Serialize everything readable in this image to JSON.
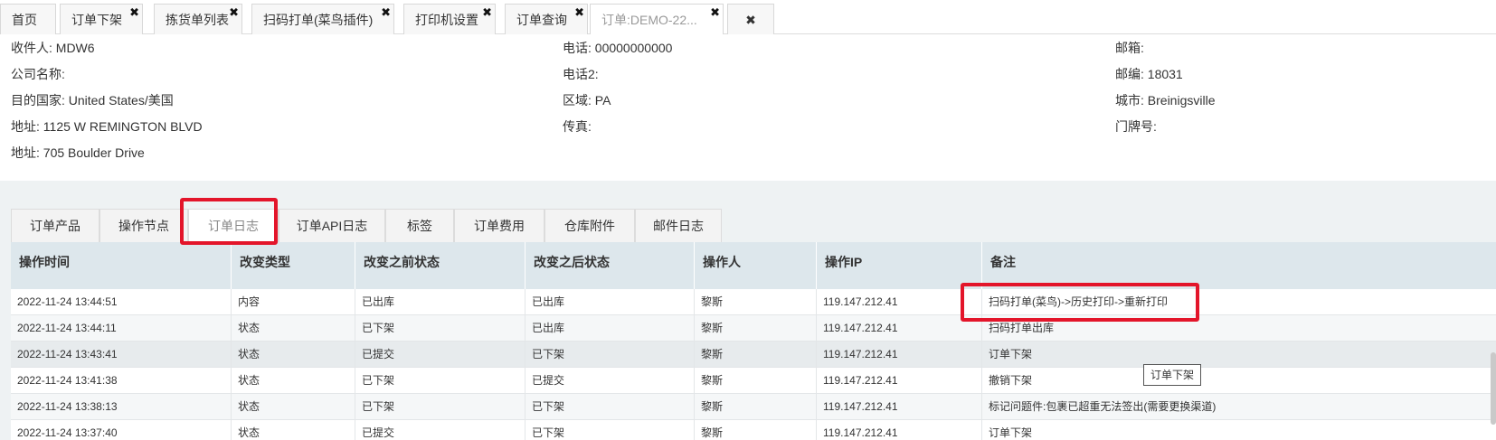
{
  "top_tabs": [
    {
      "label": "首页",
      "closable": false
    },
    {
      "label": "订单下架",
      "closable": true
    },
    {
      "label": "拣货单列表",
      "closable": true
    },
    {
      "label": "扫码打单(菜鸟插件)",
      "closable": true
    },
    {
      "label": "打印机设置",
      "closable": true
    },
    {
      "label": "订单查询",
      "closable": true
    },
    {
      "label": "订单:DEMO-22...",
      "closable": true,
      "active": true
    }
  ],
  "close_all_glyph": "✖",
  "close_glyph": "✖",
  "info": {
    "recipient": {
      "label": "收件人:",
      "value": " MDW6"
    },
    "phone": {
      "label": "电话:",
      "value": " 00000000000"
    },
    "email": {
      "label": "邮箱:",
      "value": ""
    },
    "company": {
      "label": "公司名称:",
      "value": ""
    },
    "phone2": {
      "label": "电话2:",
      "value": ""
    },
    "zip": {
      "label": "邮编:",
      "value": " 18031"
    },
    "country": {
      "label": "目的国家:",
      "value": " United States/美国"
    },
    "region": {
      "label": "区域:",
      "value": " PA"
    },
    "city": {
      "label": "城市:",
      "value": " Breinigsville"
    },
    "address1": {
      "label": "地址:",
      "value": " 1125 W REMINGTON BLVD"
    },
    "fax": {
      "label": "传真:",
      "value": ""
    },
    "door": {
      "label": "门牌号:",
      "value": ""
    },
    "address2": {
      "label": "地址:",
      "value": " 705 Boulder Drive"
    }
  },
  "detail_tabs": [
    {
      "label": "订单产品"
    },
    {
      "label": "操作节点"
    },
    {
      "label": "订单日志",
      "active": true
    },
    {
      "label": "订单API日志"
    },
    {
      "label": "标签"
    },
    {
      "label": "订单费用"
    },
    {
      "label": "仓库附件"
    },
    {
      "label": "邮件日志"
    }
  ],
  "log_table": {
    "columns": [
      "操作时间",
      "改变类型",
      "改变之前状态",
      "改变之后状态",
      "操作人",
      "操作IP",
      "备注"
    ],
    "rows": [
      [
        "2022-11-24 13:44:51",
        "内容",
        "已出库",
        "已出库",
        "黎斯",
        "119.147.212.41",
        "扫码打单(菜鸟)->历史打印->重新打印"
      ],
      [
        "2022-11-24 13:44:11",
        "状态",
        "已下架",
        "已出库",
        "黎斯",
        "119.147.212.41",
        "扫码打单出库"
      ],
      [
        "2022-11-24 13:43:41",
        "状态",
        "已提交",
        "已下架",
        "黎斯",
        "119.147.212.41",
        "订单下架"
      ],
      [
        "2022-11-24 13:41:38",
        "状态",
        "已下架",
        "已提交",
        "黎斯",
        "119.147.212.41",
        "撤销下架"
      ],
      [
        "2022-11-24 13:38:13",
        "状态",
        "已下架",
        "已下架",
        "黎斯",
        "119.147.212.41",
        "标记问题件:包裹已超重无法签出(需要更换渠道)"
      ],
      [
        "2022-11-24 13:37:40",
        "状态",
        "已提交",
        "已下架",
        "黎斯",
        "119.147.212.41",
        "订单下架"
      ]
    ]
  },
  "tooltip": "订单下架",
  "colors": {
    "highlight_box": "#e3152a",
    "header_bg": "#dde7ec"
  }
}
